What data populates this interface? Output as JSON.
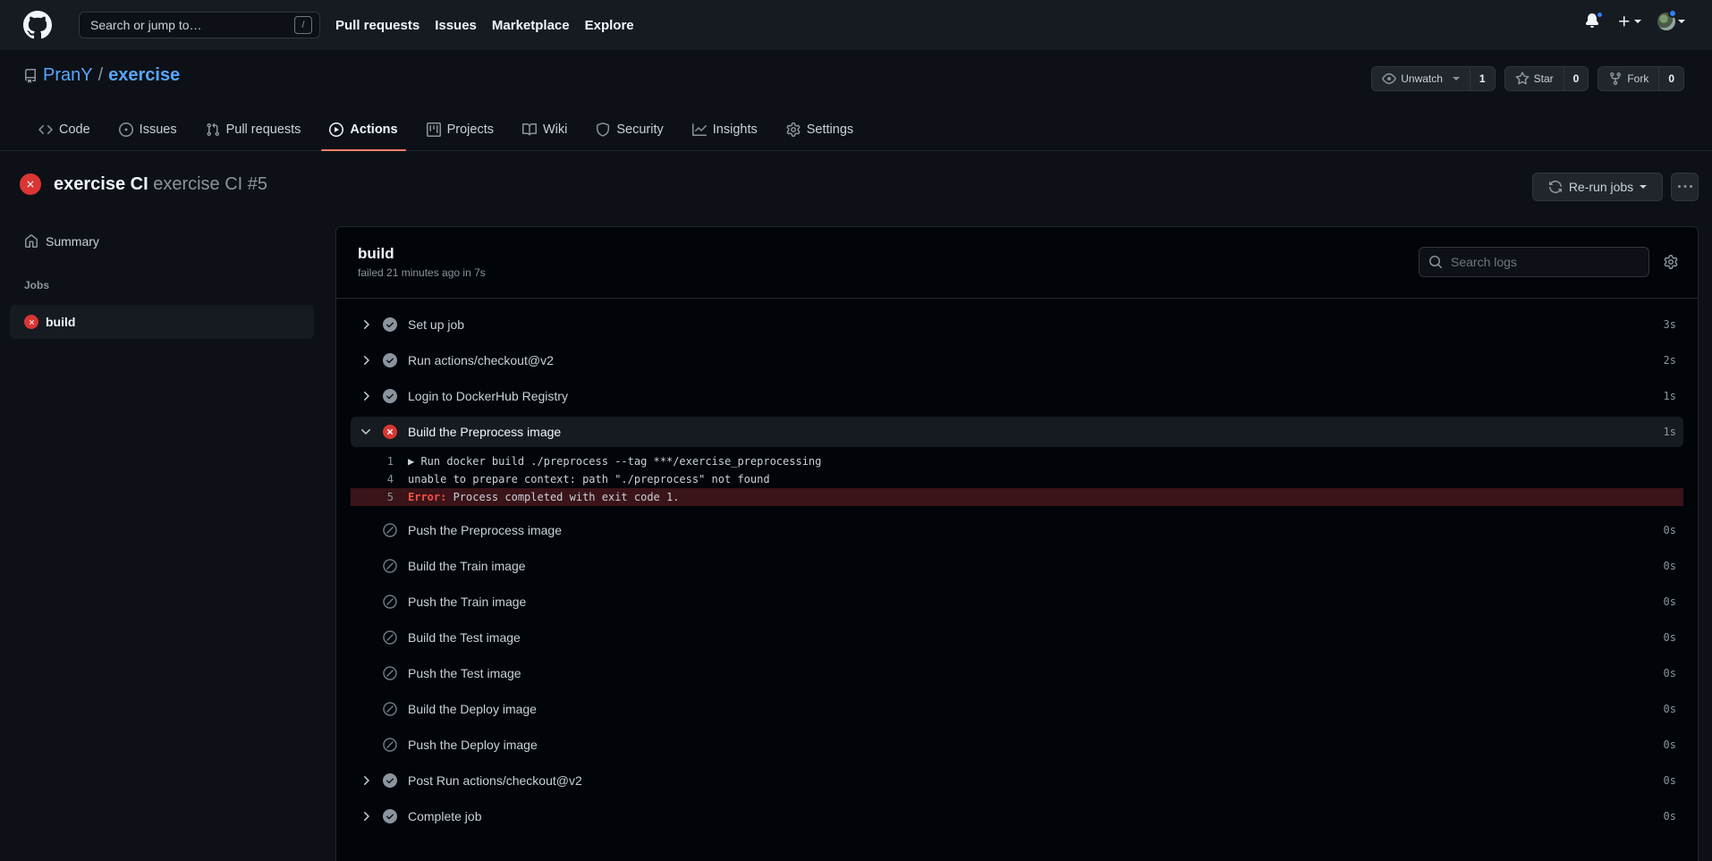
{
  "header": {
    "search_placeholder": "Search or jump to…",
    "search_shortcut": "/",
    "nav": [
      "Pull requests",
      "Issues",
      "Marketplace",
      "Explore"
    ]
  },
  "repo": {
    "owner": "PranY",
    "separator": "/",
    "name": "exercise",
    "watch_label": "Unwatch",
    "watch_count": "1",
    "star_label": "Star",
    "star_count": "0",
    "fork_label": "Fork",
    "fork_count": "0"
  },
  "tabs": [
    {
      "label": "Code",
      "icon": "code-icon"
    },
    {
      "label": "Issues",
      "icon": "issue-icon"
    },
    {
      "label": "Pull requests",
      "icon": "pull-request-icon"
    },
    {
      "label": "Actions",
      "icon": "play-icon",
      "active": true
    },
    {
      "label": "Projects",
      "icon": "project-icon"
    },
    {
      "label": "Wiki",
      "icon": "book-icon"
    },
    {
      "label": "Security",
      "icon": "shield-icon"
    },
    {
      "label": "Insights",
      "icon": "graph-icon"
    },
    {
      "label": "Settings",
      "icon": "gear-icon"
    }
  ],
  "run": {
    "workflow": "exercise CI",
    "run_name": "exercise CI #5",
    "rerun_label": "Re-run jobs"
  },
  "sidebar": {
    "summary": "Summary",
    "jobs_heading": "Jobs",
    "jobs": [
      {
        "name": "build",
        "status": "failure"
      }
    ]
  },
  "job": {
    "name": "build",
    "meta": "failed 21 minutes ago in 7s",
    "search_placeholder": "Search logs",
    "steps": [
      {
        "label": "Set up job",
        "status": "success",
        "duration": "3s"
      },
      {
        "label": "Run actions/checkout@v2",
        "status": "success",
        "duration": "2s"
      },
      {
        "label": "Login to DockerHub Registry",
        "status": "success",
        "duration": "1s"
      },
      {
        "label": "Build the Preprocess image",
        "status": "failure",
        "duration": "1s",
        "expanded": true
      },
      {
        "label": "Push the Preprocess image",
        "status": "skipped",
        "duration": "0s"
      },
      {
        "label": "Build the Train image",
        "status": "skipped",
        "duration": "0s"
      },
      {
        "label": "Push the Train image",
        "status": "skipped",
        "duration": "0s"
      },
      {
        "label": "Build the Test image",
        "status": "skipped",
        "duration": "0s"
      },
      {
        "label": "Push the Test image",
        "status": "skipped",
        "duration": "0s"
      },
      {
        "label": "Build the Deploy image",
        "status": "skipped",
        "duration": "0s"
      },
      {
        "label": "Push the Deploy image",
        "status": "skipped",
        "duration": "0s"
      },
      {
        "label": "Post Run actions/checkout@v2",
        "status": "success",
        "duration": "0s"
      },
      {
        "label": "Complete job",
        "status": "success",
        "duration": "0s"
      }
    ],
    "log": [
      {
        "n": "1",
        "text": "▶ Run docker build ./preprocess --tag ***/exercise_preprocessing"
      },
      {
        "n": "4",
        "text": "unable to prepare context: path \"./preprocess\" not found"
      },
      {
        "n": "5",
        "error_key": "Error:",
        "text": " Process completed with exit code 1."
      }
    ]
  },
  "colors": {
    "background": "#0d1117",
    "header": "#161b22",
    "link": "#58a6ff",
    "failure": "#da3633",
    "success_icon": "#8b949e",
    "active_tab_underline": "#f78166",
    "error_line_bg": "#3a1418"
  }
}
